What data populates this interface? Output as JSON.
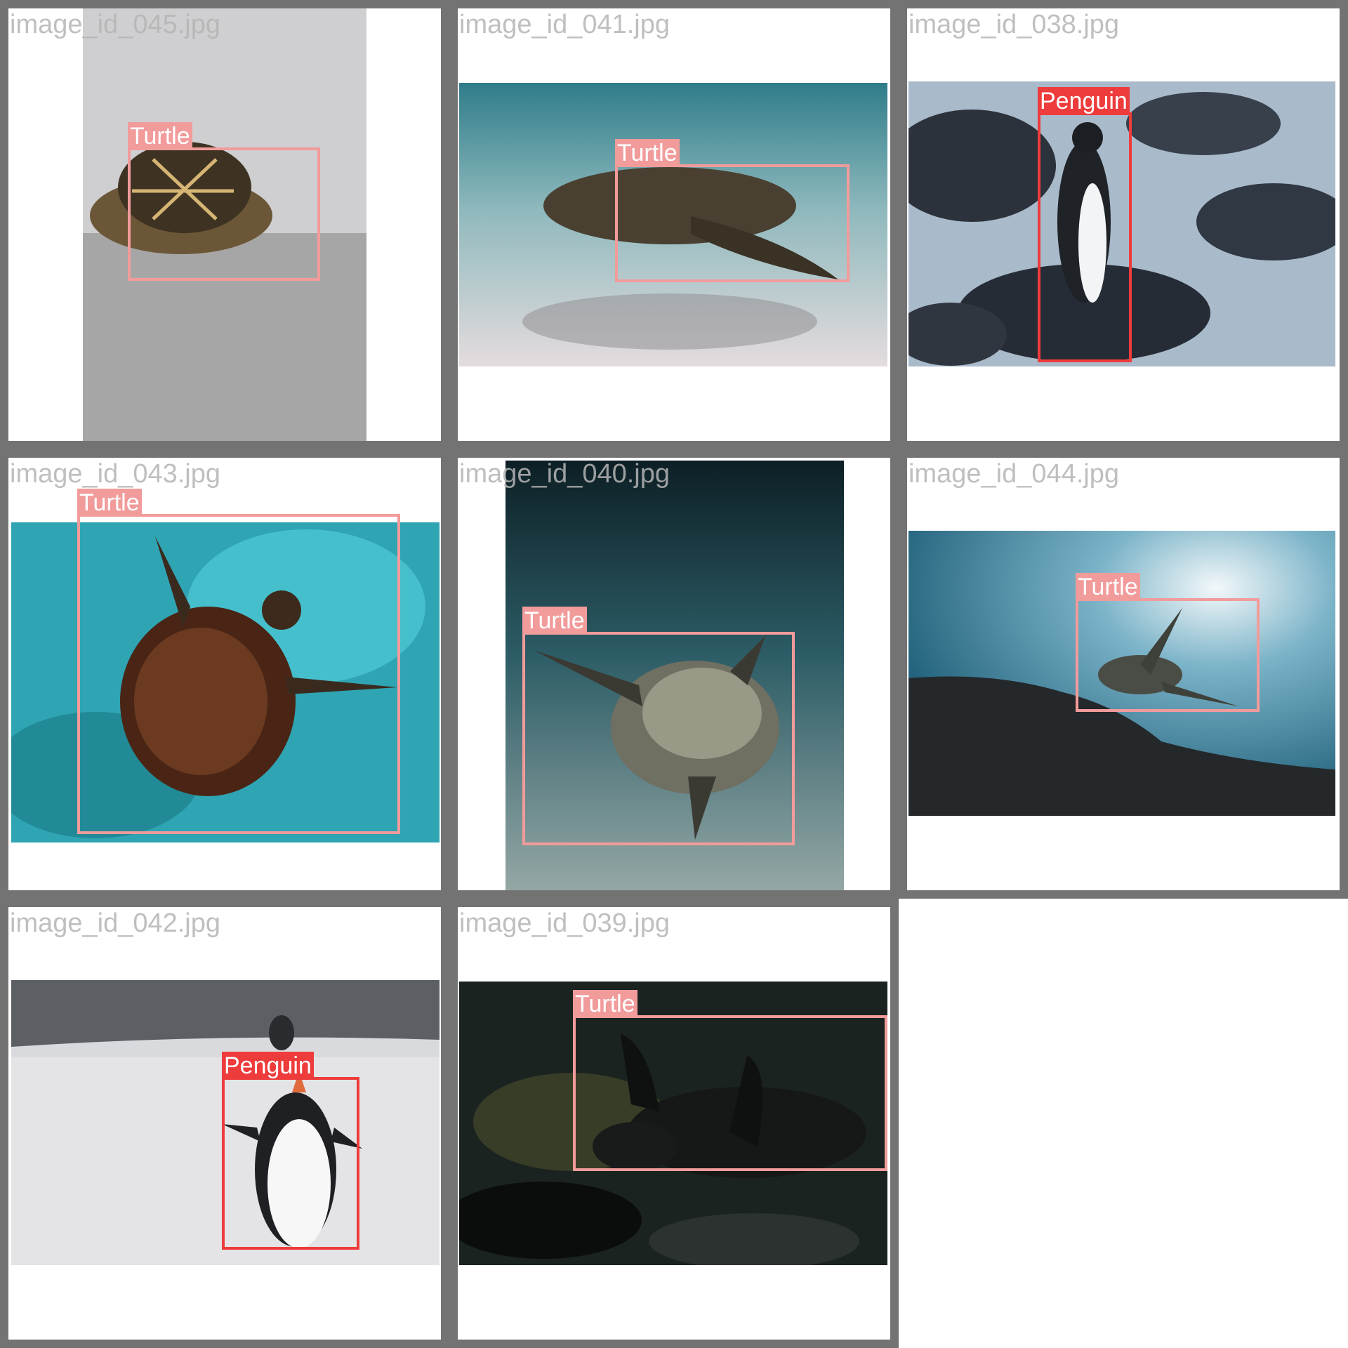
{
  "tiles": [
    {
      "filename": "image_id_045.jpg",
      "label": "Turtle",
      "palette": [
        "#c9c9cb",
        "#8d8c8a",
        "#4f4030"
      ]
    },
    {
      "filename": "image_id_041.jpg",
      "label": "Turtle",
      "palette": [
        "#3c8b98",
        "#cfd3d2",
        "#3a3428"
      ]
    },
    {
      "filename": "image_id_038.jpg",
      "label": "Penguin",
      "palette": [
        "#2c333d",
        "#9db1c6",
        "#f4f6f8"
      ]
    },
    {
      "filename": "image_id_043.jpg",
      "label": "Turtle",
      "palette": [
        "#2b9aa8",
        "#55d3df",
        "#4a2616"
      ]
    },
    {
      "filename": "image_id_040.jpg",
      "label": "Turtle",
      "palette": [
        "#10262d",
        "#2f6671",
        "#8a8d80"
      ]
    },
    {
      "filename": "image_id_044.jpg",
      "label": "Turtle",
      "palette": [
        "#3f86a6",
        "#e8f3f7",
        "#202428"
      ]
    },
    {
      "filename": "image_id_042.jpg",
      "label": "Penguin",
      "palette": [
        "#e3e3e6",
        "#5c5f63",
        "#1c1c1f"
      ]
    },
    {
      "filename": "image_id_039.jpg",
      "label": "Turtle",
      "palette": [
        "#1c2422",
        "#4b5230",
        "#0c0e0d"
      ]
    }
  ],
  "colors": {
    "turtle": "#f29b9b",
    "penguin": "#ee3b3b",
    "border": "#737373",
    "filename": "#b5b5b5"
  }
}
